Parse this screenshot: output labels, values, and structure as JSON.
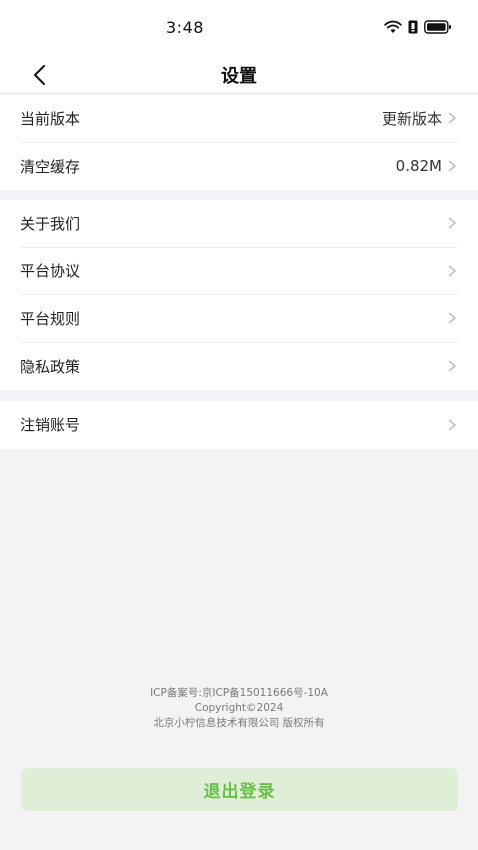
{
  "status_bar": {
    "time": "3:48",
    "icons": [
      "wifi-icon",
      "sim-icon",
      "battery-icon"
    ]
  },
  "nav": {
    "back_icon": "chevron-left-icon",
    "title": "设置"
  },
  "groups": [
    {
      "items": [
        {
          "label": "当前版本",
          "value": "更新版本"
        },
        {
          "label": "清空缓存",
          "value": "0.82M"
        }
      ]
    },
    {
      "items": [
        {
          "label": "关于我们",
          "value": ""
        },
        {
          "label": "平台协议",
          "value": ""
        },
        {
          "label": "平台规则",
          "value": ""
        },
        {
          "label": "隐私政策",
          "value": ""
        }
      ]
    },
    {
      "items": [
        {
          "label": "注销账号",
          "value": ""
        }
      ]
    }
  ],
  "footer": {
    "icp": "ICP备案号:京ICP备15011666号-10A",
    "copyright": "Copyright©2024",
    "company": "北京小柠信息技术有限公司 版权所有"
  },
  "logout": {
    "label": "退出登录"
  },
  "colors": {
    "background": "#f3f3f5",
    "accent_green": "#6cc04a",
    "logout_bg": "#dfeed7"
  }
}
